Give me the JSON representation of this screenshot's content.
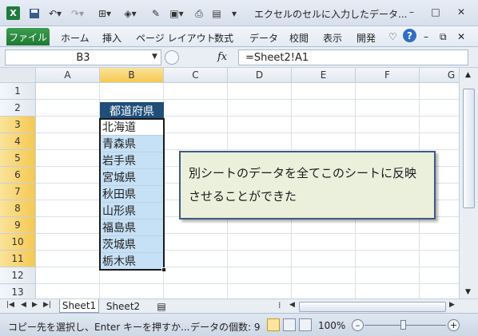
{
  "window": {
    "title": "エクセルのセルに入力したデータ...",
    "app_icon": "X",
    "minimize": "–",
    "restore": "□",
    "close": "✕"
  },
  "ribbon": {
    "file": "ファイル",
    "tabs": [
      "ホーム",
      "挿入",
      "ページ レイアウト",
      "数式",
      "データ",
      "校閲",
      "表示",
      "開発"
    ]
  },
  "formula_bar": {
    "name_box": "B3",
    "fx": "fx",
    "formula": "=Sheet2!A1"
  },
  "columns": [
    "A",
    "B",
    "C",
    "D",
    "E",
    "F",
    "G"
  ],
  "rows": [
    "1",
    "2",
    "3",
    "4",
    "5",
    "6",
    "7",
    "8",
    "9",
    "10",
    "11",
    "12",
    "13"
  ],
  "table": {
    "header": "都道府県",
    "cells": [
      "北海道",
      "青森県",
      "岩手県",
      "宮城県",
      "秋田県",
      "山形県",
      "福島県",
      "茨城県",
      "栃木県"
    ]
  },
  "callout": {
    "line1": "別シートのデータを全てこのシートに反映",
    "line2": "させることができた"
  },
  "sheets": [
    "Sheet1",
    "Sheet2"
  ],
  "status": {
    "message": "コピー先を選択し、Enter キーを押すか...",
    "count": "データの個数: 9",
    "zoom": "100%"
  },
  "colors": {
    "header_bg": "#1f4e79",
    "selection_bg": "#c6e0f5",
    "callout_bg": "#ebf0dc",
    "file_tab": "#1f7a33"
  }
}
